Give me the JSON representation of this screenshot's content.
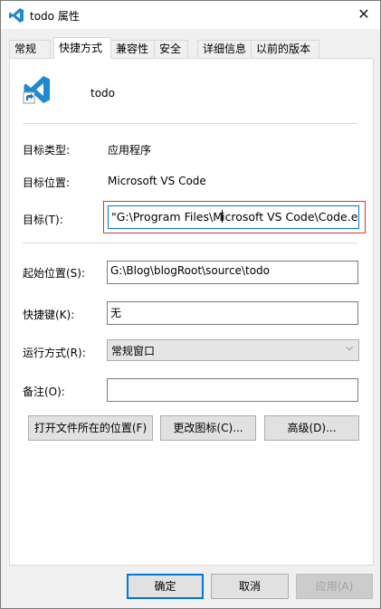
{
  "window": {
    "title": "todo 属性",
    "close_glyph": "✕"
  },
  "tabs": [
    {
      "label": "常规"
    },
    {
      "label": "快捷方式"
    },
    {
      "label": "兼容性"
    },
    {
      "label": "安全"
    },
    {
      "label": "详细信息"
    },
    {
      "label": "以前的版本"
    }
  ],
  "shortcut": {
    "name": "todo",
    "target_type_label": "目标类型:",
    "target_type_value": "应用程序",
    "target_location_label": "目标位置:",
    "target_location_value": "Microsoft VS Code",
    "target_label": "目标(T):",
    "target_value_pre": "\"G:\\Program Files\\M",
    "target_value_post": "icrosoft VS Code\\Code.exe",
    "start_in_label": "起始位置(S):",
    "start_in_value": "G:\\Blog\\blogRoot\\source\\todo",
    "hotkey_label": "快捷键(K):",
    "hotkey_value": "无",
    "run_label": "运行方式(R):",
    "run_value": "常规窗口",
    "comment_label": "备注(O):",
    "comment_value": ""
  },
  "buttons": {
    "open_location": "打开文件所在的位置(F)",
    "change_icon": "更改图标(C)...",
    "advanced": "高级(D)...",
    "ok": "确定",
    "cancel": "取消",
    "apply": "应用(A)"
  },
  "colors": {
    "vscode_blue": "#1f8ad2",
    "focus_blue": "#0078d7",
    "highlight_red": "#e0312b"
  }
}
